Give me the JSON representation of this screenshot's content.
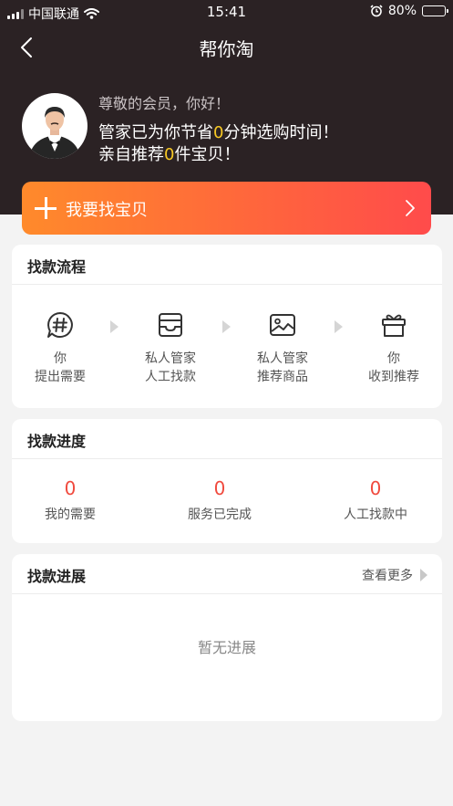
{
  "status_bar": {
    "carrier": "中国联通",
    "time": "15:41",
    "battery": "80%",
    "battery_level": 0.8
  },
  "nav": {
    "title": "帮你淘"
  },
  "profile": {
    "greeting": "尊敬的会员，你好！",
    "saved_prefix": "管家已为你节省",
    "saved_minutes": "0",
    "saved_suffix": "分钟选购时间！",
    "rec_prefix": "亲自推荐",
    "rec_count": "0",
    "rec_suffix": "件宝贝！"
  },
  "cta": {
    "label": "我要找宝贝"
  },
  "flow": {
    "title": "找款流程",
    "steps": [
      {
        "icon": "hashtag-chat-icon",
        "line1": "你",
        "line2": "提出需要"
      },
      {
        "icon": "inbox-tray-icon",
        "line1": "私人管家",
        "line2": "人工找款"
      },
      {
        "icon": "picture-icon",
        "line1": "私人管家",
        "line2": "推荐商品"
      },
      {
        "icon": "gift-icon",
        "line1": "你",
        "line2": "收到推荐"
      }
    ]
  },
  "progress": {
    "title": "找款进度",
    "stats": [
      {
        "value": "0",
        "label": "我的需要"
      },
      {
        "value": "0",
        "label": "服务已完成"
      },
      {
        "value": "0",
        "label": "人工找款中"
      }
    ]
  },
  "updates": {
    "title": "找款进展",
    "more_label": "查看更多",
    "empty_text": "暂无进展"
  },
  "colors": {
    "header_bg": "#2b2224",
    "highlight": "#f7c824",
    "accent_red": "#f04a3e",
    "cta_start": "#ff8a2b",
    "cta_end": "#ff4b4b"
  }
}
